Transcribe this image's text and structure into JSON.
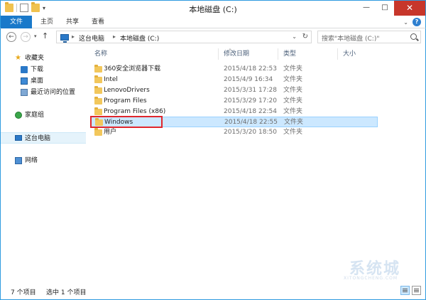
{
  "window": {
    "title": "本地磁盘 (C:)",
    "min_glyph": "—",
    "max_glyph": "□",
    "close_glyph": "✕"
  },
  "ribbon": {
    "tabs": [
      "文件",
      "主页",
      "共享",
      "查看"
    ],
    "expand_glyph": "⌄",
    "help_glyph": "?"
  },
  "address": {
    "crumbs": [
      "这台电脑",
      "本地磁盘 (C:)"
    ],
    "separator": "▸",
    "search_placeholder": "搜索\"本地磁盘 (C:)\"",
    "back_glyph": "←",
    "forward_glyph": "→",
    "recent_glyph": "▾",
    "up_glyph": "↑",
    "dropdown_glyph": "⌄",
    "refresh_glyph": "↻"
  },
  "nav": {
    "favorites": "收藏夹",
    "favorite_items": [
      "下载",
      "桌面",
      "最近访问的位置"
    ],
    "homegroup": "家庭组",
    "this_pc": "这台电脑",
    "network": "网络",
    "star_glyph": "★"
  },
  "columns": {
    "name": "名称",
    "date": "修改日期",
    "type": "类型",
    "size": "大小",
    "sort_glyph": "^"
  },
  "files": [
    {
      "name": "360安全浏览器下载",
      "date": "2015/4/18 22:53",
      "type": "文件夹"
    },
    {
      "name": "Intel",
      "date": "2015/4/9 16:34",
      "type": "文件夹"
    },
    {
      "name": "LenovoDrivers",
      "date": "2015/3/31 17:28",
      "type": "文件夹"
    },
    {
      "name": "Program Files",
      "date": "2015/3/29 17:20",
      "type": "文件夹"
    },
    {
      "name": "Program Files (x86)",
      "date": "2015/4/18 22:54",
      "type": "文件夹"
    },
    {
      "name": "Windows",
      "date": "2015/4/18 22:55",
      "type": "文件夹"
    },
    {
      "name": "用户",
      "date": "2015/3/20 18:50",
      "type": "文件夹"
    }
  ],
  "selected_index": 5,
  "status": {
    "count": "7 个项目",
    "selected": "选中 1 个项目"
  },
  "watermark": {
    "text": "系统城",
    "sub": "XITONGCHENG.COM"
  },
  "colors": {
    "accent": "#2f9be0",
    "file_tab": "#1979ca",
    "selection": "#cce8ff",
    "highlight_box": "#e0272d",
    "close_button": "#c7362b"
  }
}
